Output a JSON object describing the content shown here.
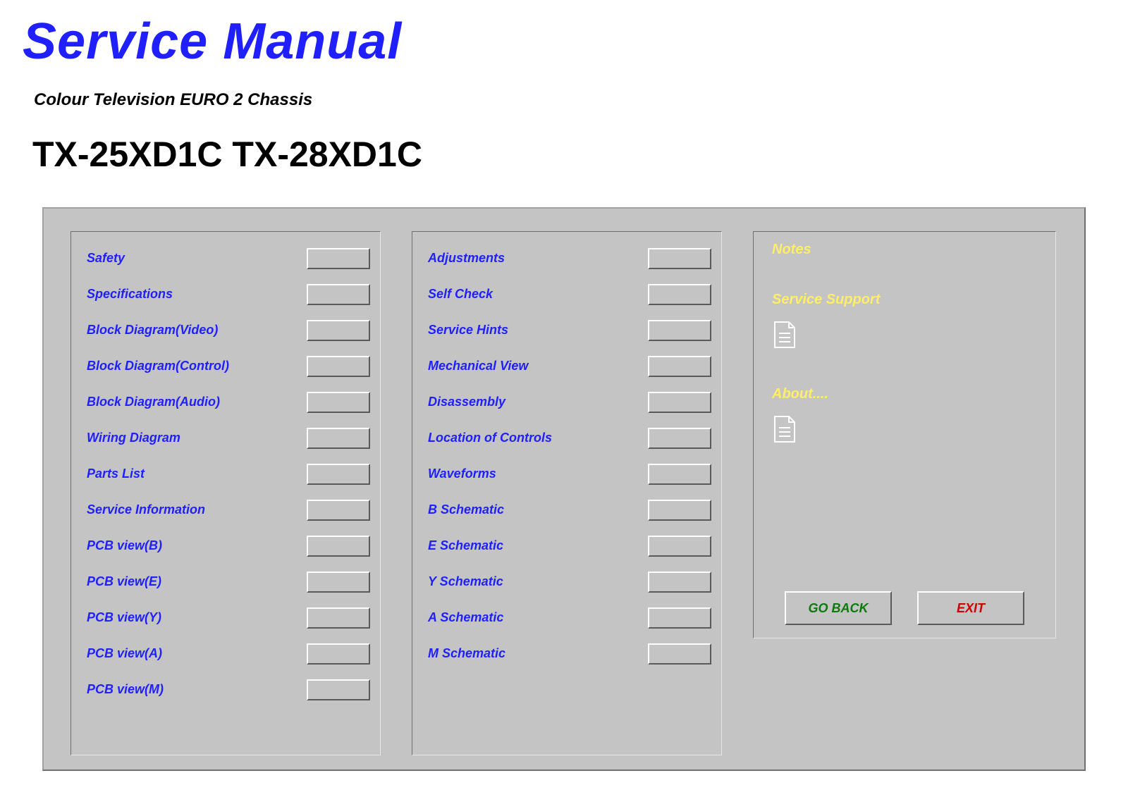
{
  "header": {
    "title": "Service Manual",
    "subtitle": "Colour Television EURO 2 Chassis",
    "model": "TX-25XD1C TX-28XD1C"
  },
  "columns": {
    "left": [
      {
        "label": "Safety"
      },
      {
        "label": "Specifications"
      },
      {
        "label": "Block Diagram(Video)"
      },
      {
        "label": "Block Diagram(Control)"
      },
      {
        "label": "Block Diagram(Audio)"
      },
      {
        "label": "Wiring Diagram"
      },
      {
        "label": "Parts List"
      },
      {
        "label": "Service Information"
      },
      {
        "label": "PCB view(B)"
      },
      {
        "label": "PCB view(E)"
      },
      {
        "label": "PCB view(Y)"
      },
      {
        "label": "PCB view(A)"
      },
      {
        "label": "PCB view(M)"
      }
    ],
    "middle": [
      {
        "label": "Adjustments"
      },
      {
        "label": "Self Check"
      },
      {
        "label": "Service Hints"
      },
      {
        "label": "Mechanical View"
      },
      {
        "label": "Disassembly"
      },
      {
        "label": "Location of Controls"
      },
      {
        "label": "Waveforms"
      },
      {
        "label": "B Schematic"
      },
      {
        "label": "E Schematic"
      },
      {
        "label": "Y Schematic"
      },
      {
        "label": "A Schematic"
      },
      {
        "label": "M Schematic"
      }
    ]
  },
  "right": {
    "notes_heading": "Notes",
    "service_support_heading": "Service Support",
    "about_heading": "About....",
    "go_back_label": "GO BACK",
    "exit_label": "EXIT"
  }
}
